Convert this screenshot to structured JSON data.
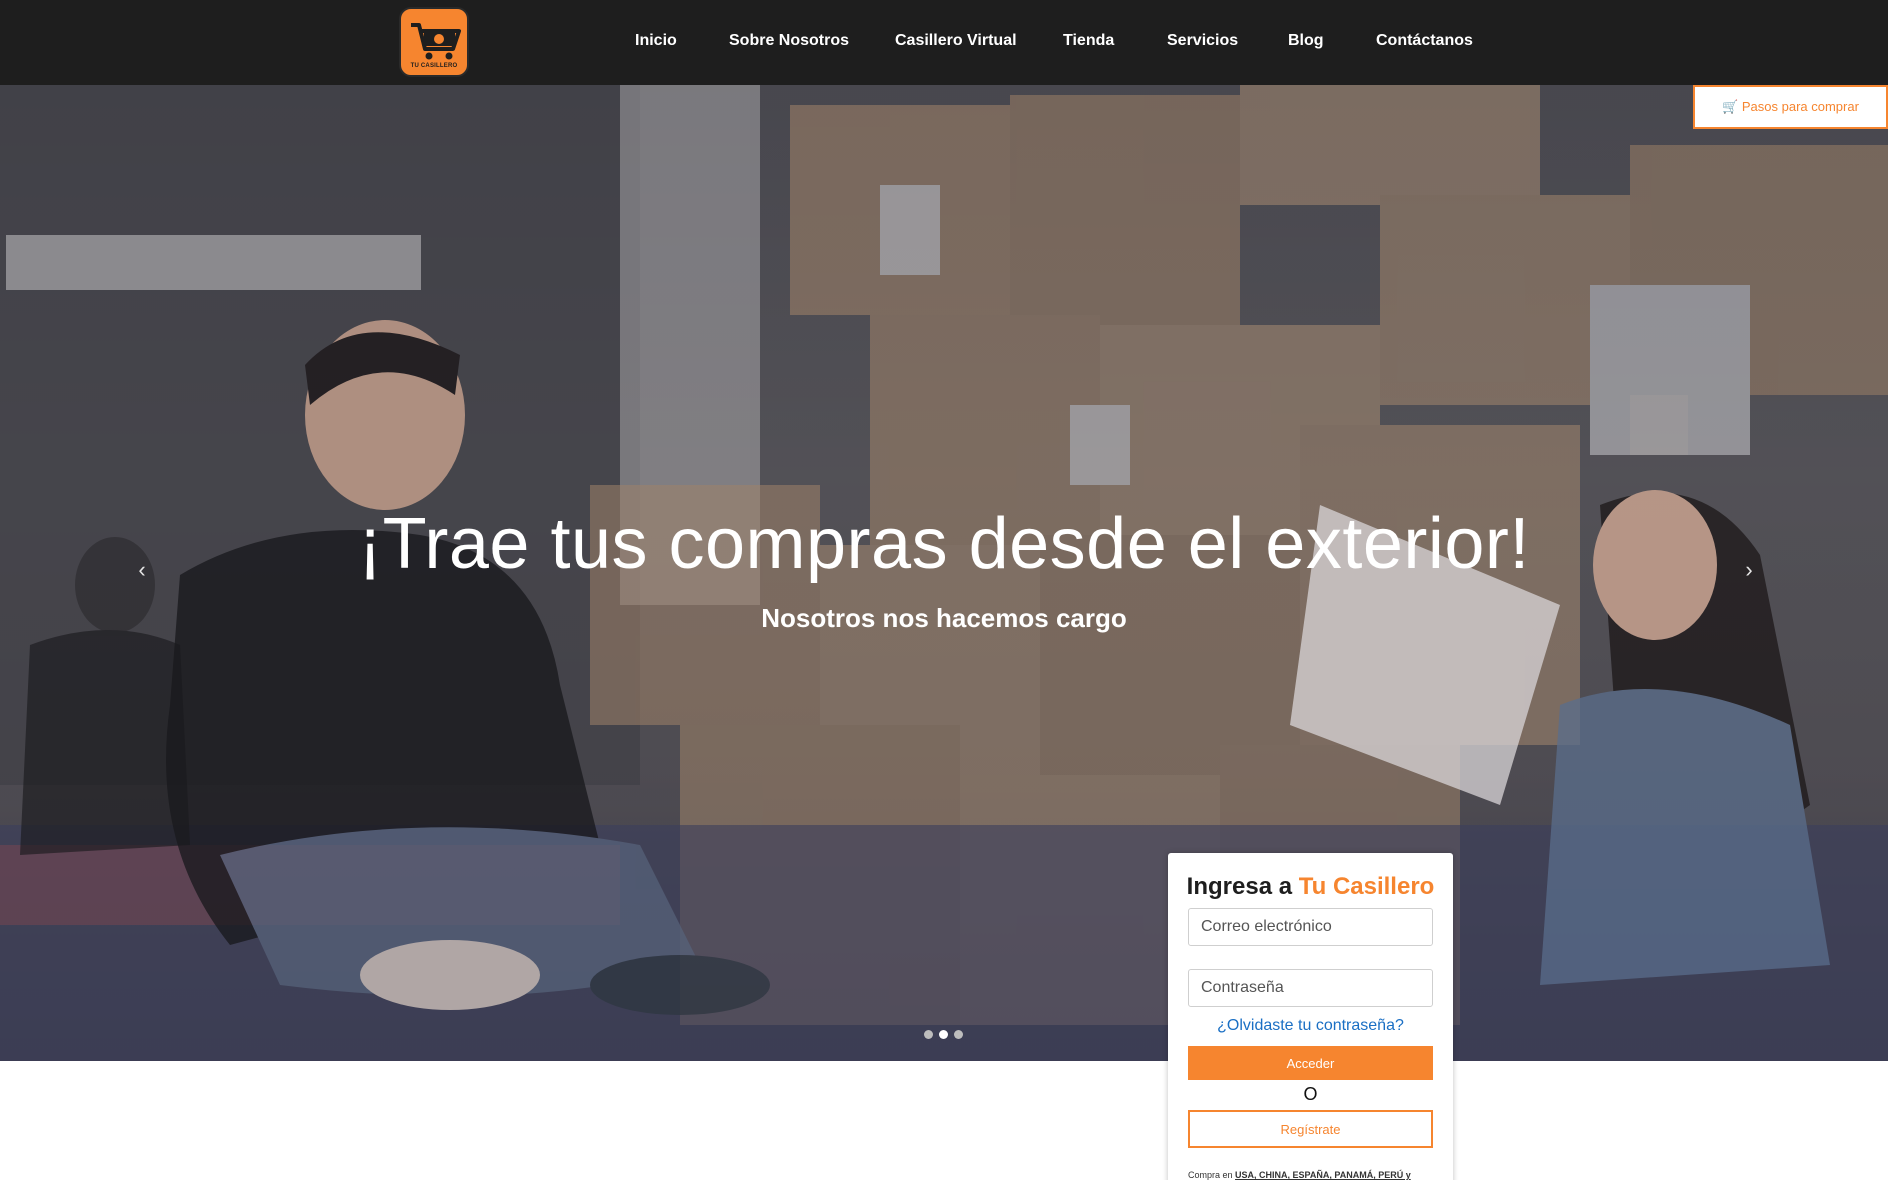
{
  "brand": {
    "logo_text": "TU CASILLERO",
    "accent": "#f6852f",
    "nav_bg": "#1e1e1e"
  },
  "nav": {
    "items": [
      {
        "label": "Inicio"
      },
      {
        "label": "Sobre Nosotros"
      },
      {
        "label": "Casillero Virtual"
      },
      {
        "label": "Tienda"
      },
      {
        "label": "Servicios"
      },
      {
        "label": "Blog"
      },
      {
        "label": "Contáctanos"
      }
    ]
  },
  "steps_button": {
    "icon": "cart-icon",
    "label": "Pasos para comprar"
  },
  "hero": {
    "title": "¡Trae tus compras desde el exterior!",
    "subtitle": "Nosotros nos hacemos cargo",
    "prev_icon": "chevron-left-icon",
    "next_icon": "chevron-right-icon",
    "slides": 3,
    "active_slide": 2
  },
  "login": {
    "title_prefix": "Ingresa a",
    "title_accent": "Tu Casillero",
    "email_placeholder": "Correo electrónico",
    "password_placeholder": "Contraseña",
    "forgot_label": "¿Olvidaste tu contraseña?",
    "submit_label": "Acceder",
    "or_label": "O",
    "register_label": "Regístrate",
    "countries_prefix": "Compra en",
    "countries": "USA, CHINA, ESPAÑA, PANAMÁ, PERÚ y"
  }
}
